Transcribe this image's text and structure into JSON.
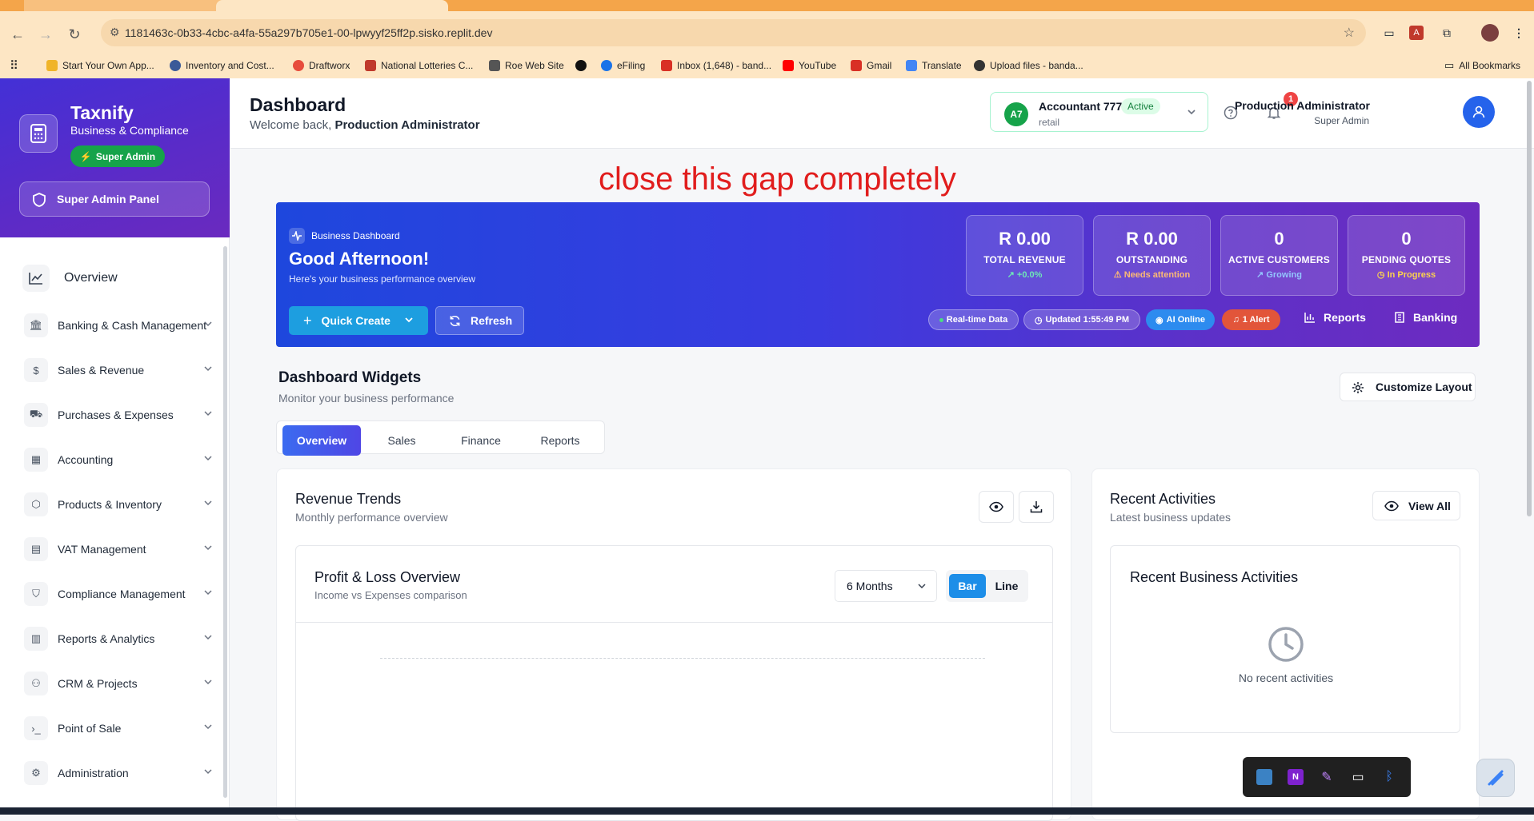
{
  "browser": {
    "url": "1181463c-0b33-4cbc-a4fa-55a297b705e1-00-lpwyyf25ff2p.sisko.replit.dev",
    "bookmarks": [
      "Start Your Own App...",
      "Inventory and Cost...",
      "Draftworx",
      "National Lotteries C...",
      "Roe Web Site",
      "",
      "eFiling",
      "Inbox (1,648) - band...",
      "YouTube",
      "Gmail",
      "Translate",
      "Upload files - banda..."
    ],
    "all_bookmarks": "All Bookmarks"
  },
  "sidebar": {
    "brand": "Taxnify",
    "brand_sub": "Business & Compliance",
    "role_badge": "Super Admin",
    "panel_button": "Super Admin Panel",
    "overview": "Overview",
    "items": [
      {
        "label": "Banking & Cash Management",
        "icon": "bank-icon"
      },
      {
        "label": "Sales & Revenue",
        "icon": "dollar-icon"
      },
      {
        "label": "Purchases & Expenses",
        "icon": "truck-icon"
      },
      {
        "label": "Accounting",
        "icon": "calculator-icon"
      },
      {
        "label": "Products & Inventory",
        "icon": "box-icon"
      },
      {
        "label": "VAT Management",
        "icon": "receipt-icon"
      },
      {
        "label": "Compliance Management",
        "icon": "shield-icon"
      },
      {
        "label": "Reports & Analytics",
        "icon": "bar-chart-icon"
      },
      {
        "label": "CRM & Projects",
        "icon": "users-icon"
      },
      {
        "label": "Point of Sale",
        "icon": "terminal-icon"
      },
      {
        "label": "Administration",
        "icon": "gear-icon"
      }
    ]
  },
  "header": {
    "title": "Dashboard",
    "welcome": "Welcome back, ",
    "user_bold": "Production Administrator",
    "account": {
      "initials": "A7",
      "name": "Accountant 777",
      "status": "Active",
      "type": "retail"
    },
    "notifications": "1",
    "user_name": "Production Administrator",
    "user_role": "Super Admin"
  },
  "annotation": "close this gap completely",
  "banner": {
    "tag": "Business Dashboard",
    "greeting": "Good Afternoon!",
    "subtitle": "Here's your business performance overview",
    "quick_create": "Quick Create",
    "refresh": "Refresh",
    "stats": [
      {
        "value": "R 0.00",
        "label": "TOTAL REVENUE",
        "sub": "+0.0%",
        "sub_color": "#6ee7b7"
      },
      {
        "value": "R 0.00",
        "label": "OUTSTANDING",
        "sub": "Needs attention",
        "sub_color": "#fdba74"
      },
      {
        "value": "0",
        "label": "ACTIVE CUSTOMERS",
        "sub": "Growing",
        "sub_color": "#93c5fd"
      },
      {
        "value": "0",
        "label": "PENDING QUOTES",
        "sub": "In Progress",
        "sub_color": "#fcd34d"
      }
    ],
    "chips": [
      "Real-time Data",
      "Updated 1:55:49 PM",
      "AI Online",
      "1 Alert"
    ],
    "links": [
      "Reports",
      "Banking"
    ]
  },
  "widgets": {
    "title": "Dashboard Widgets",
    "subtitle": "Monitor your business performance",
    "customize": "Customize Layout",
    "tabs": [
      "Overview",
      "Sales",
      "Finance",
      "Reports"
    ],
    "active_tab": "Overview"
  },
  "revenue": {
    "title": "Revenue Trends",
    "subtitle": "Monthly performance overview",
    "pl_title": "Profit & Loss Overview",
    "pl_subtitle": "Income vs Expenses comparison",
    "period": "6 Months",
    "mode_bar": "Bar",
    "mode_line": "Line"
  },
  "activities": {
    "title": "Recent Activities",
    "subtitle": "Latest business updates",
    "view_all": "View All",
    "inner_title": "Recent Business Activities",
    "empty": "No recent activities"
  },
  "colors": {
    "accent": "#4f46e5",
    "brand": "#4330d6",
    "success": "#16a34a",
    "alert": "#ef4444"
  }
}
